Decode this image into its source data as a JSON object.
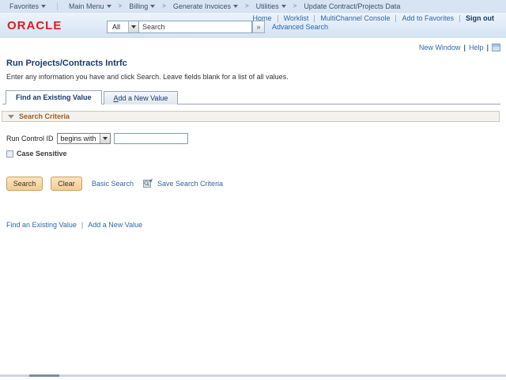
{
  "breadcrumb": {
    "favorites": "Favorites",
    "separator": ">",
    "items": [
      {
        "label": "Main Menu"
      },
      {
        "label": "Billing"
      },
      {
        "label": "Generate Invoices"
      },
      {
        "label": "Utilities"
      },
      {
        "label": "Update Contract/Projects Data"
      }
    ]
  },
  "header": {
    "logo": "ORACLE",
    "links": [
      {
        "label": "Home"
      },
      {
        "label": "Worklist"
      },
      {
        "label": "MultiChannel Console"
      },
      {
        "label": "Add to Favorites"
      }
    ],
    "sign_out": "Sign out",
    "search": {
      "scope": "All",
      "placeholder": "Search",
      "go": "»",
      "advanced": "Advanced Search"
    }
  },
  "toolbar": {
    "new_window": "New Window",
    "help": "Help",
    "pipe": "|"
  },
  "page": {
    "title": "Run Projects/Contracts Intrfc",
    "instructions": "Enter any information you have and click Search. Leave fields blank for a list of all values.",
    "tabs": {
      "find": "Find an Existing Value",
      "add_accesskey": "A",
      "add_rest": "dd a New Value"
    }
  },
  "criteria": {
    "section_title": "Search Criteria",
    "field_label": "Run Control ID",
    "operator": "begins with",
    "field_value": "",
    "case_sensitive": "Case Sensitive",
    "search_button": "Search",
    "clear_button": "Clear",
    "basic_search": "Basic Search",
    "save_search": "Save Search Criteria"
  },
  "footer": {
    "find_link": "Find an Existing Value",
    "pipe": "|",
    "add_link": "Add a New Value"
  },
  "colors": {
    "oracle_red": "#e21b1b",
    "link_blue": "#2f66a8",
    "title_navy": "#1a3a6d",
    "section_orange": "#a15c1f",
    "banner_blue": "#d9e4f2",
    "button_tan": "#f5cc92"
  }
}
